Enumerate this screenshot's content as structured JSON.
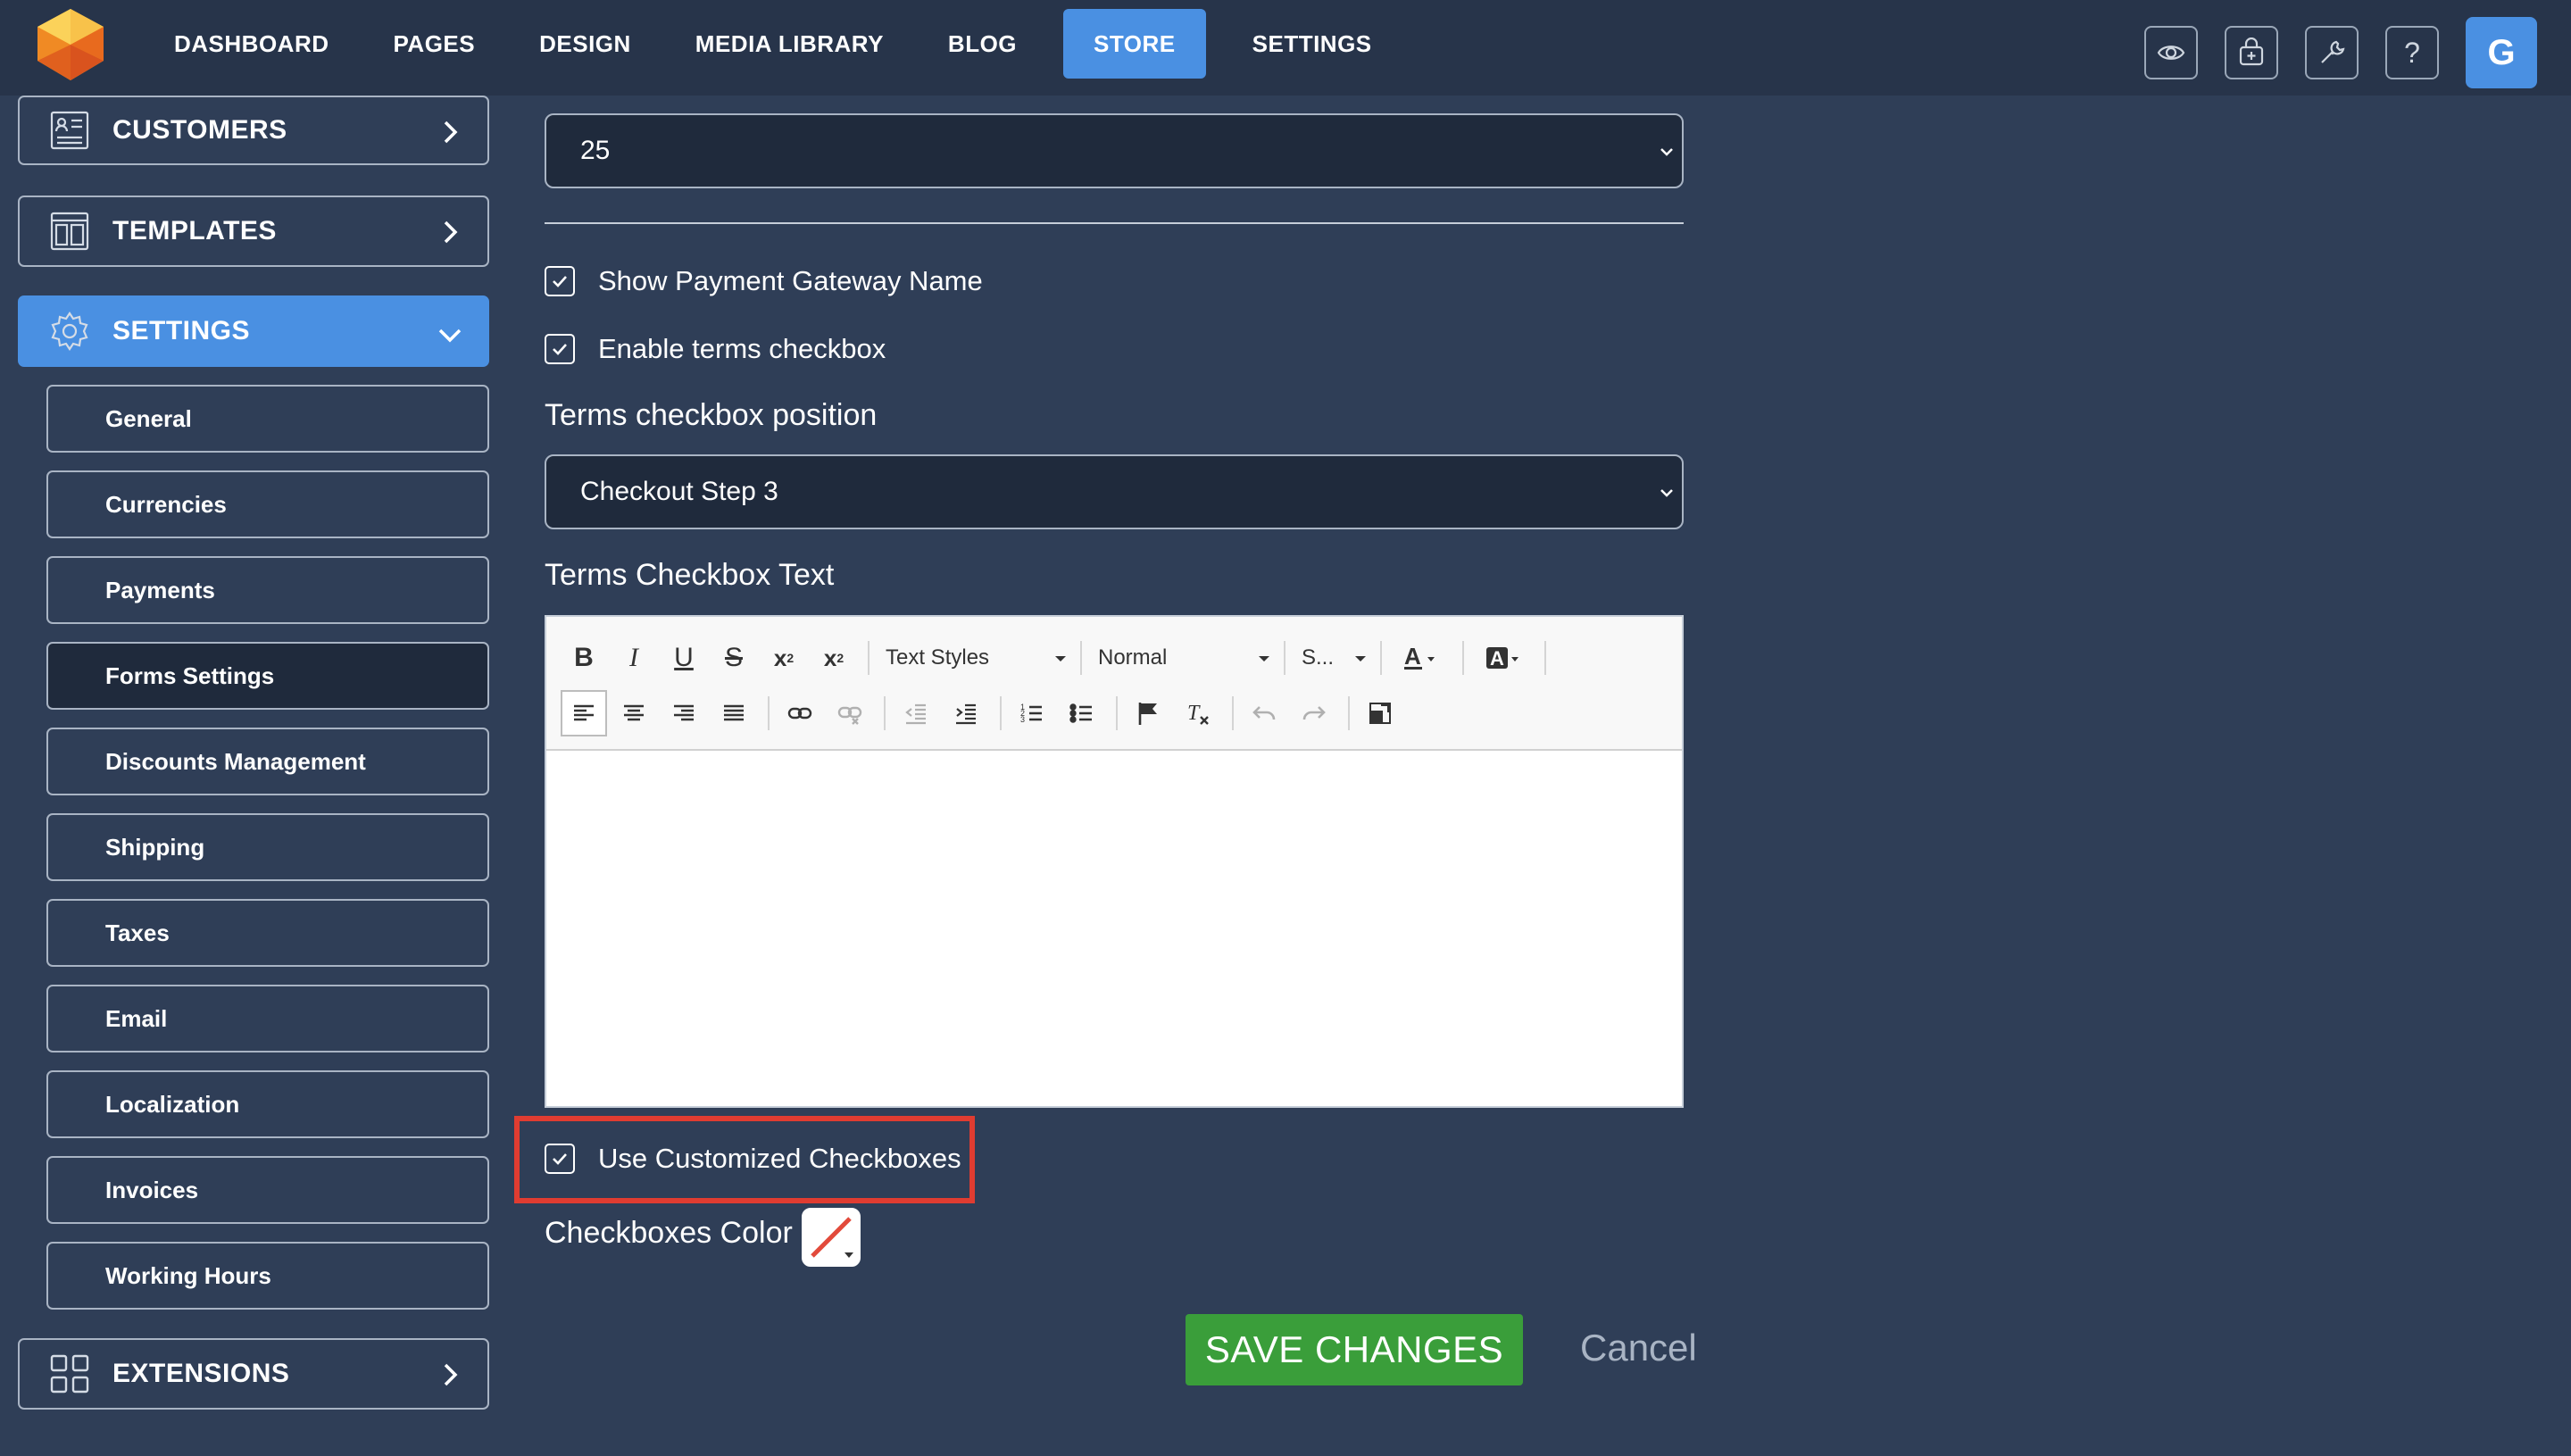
{
  "topbar": {
    "nav": [
      "DASHBOARD",
      "PAGES",
      "DESIGN",
      "MEDIA LIBRARY",
      "BLOG",
      "STORE",
      "SETTINGS"
    ],
    "active_nav": "STORE",
    "avatar_letter": "G",
    "help_label": "?"
  },
  "sidebar": {
    "customers": "CUSTOMERS",
    "templates": "TEMPLATES",
    "settings": "SETTINGS",
    "extensions": "EXTENSIONS",
    "sub_items": [
      "General",
      "Currencies",
      "Payments",
      "Forms Settings",
      "Discounts Management",
      "Shipping",
      "Taxes",
      "Email",
      "Localization",
      "Invoices",
      "Working Hours"
    ],
    "active_sub": "Forms Settings"
  },
  "form": {
    "top_select_value": "25",
    "show_gateway_label": "Show Payment Gateway Name",
    "enable_terms_label": "Enable terms checkbox",
    "terms_position_label": "Terms checkbox position",
    "terms_position_value": "Checkout Step 3",
    "terms_text_label": "Terms Checkbox Text",
    "editor": {
      "text_styles": "Text Styles",
      "format": "Normal",
      "size": "S..."
    },
    "custom_checkboxes_label": "Use Customized Checkboxes",
    "checkbox_color_label": "Checkboxes Color",
    "save_label": "SAVE CHANGES",
    "cancel_label": "Cancel"
  },
  "colors": {
    "background": "#2f3e57",
    "topbar": "#27344a",
    "accent": "#4a90e2",
    "save": "#3a9e3a",
    "highlight": "#e03c31"
  }
}
